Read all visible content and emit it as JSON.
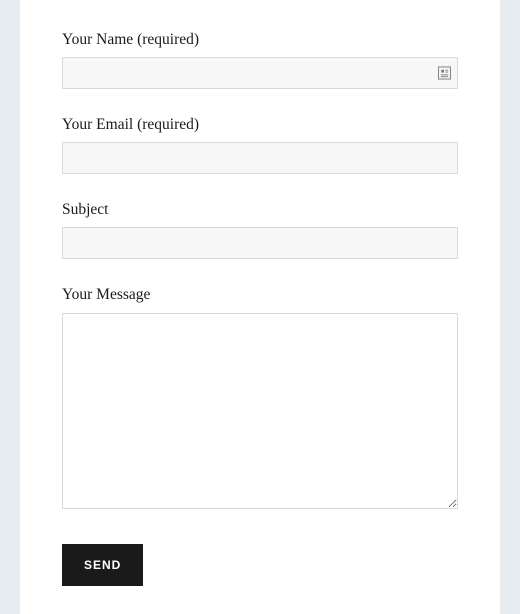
{
  "form": {
    "name": {
      "label": "Your Name (required)",
      "value": ""
    },
    "email": {
      "label": "Your Email (required)",
      "value": ""
    },
    "subject": {
      "label": "Subject",
      "value": ""
    },
    "message": {
      "label": "Your Message",
      "value": ""
    },
    "submit_label": "Send"
  }
}
